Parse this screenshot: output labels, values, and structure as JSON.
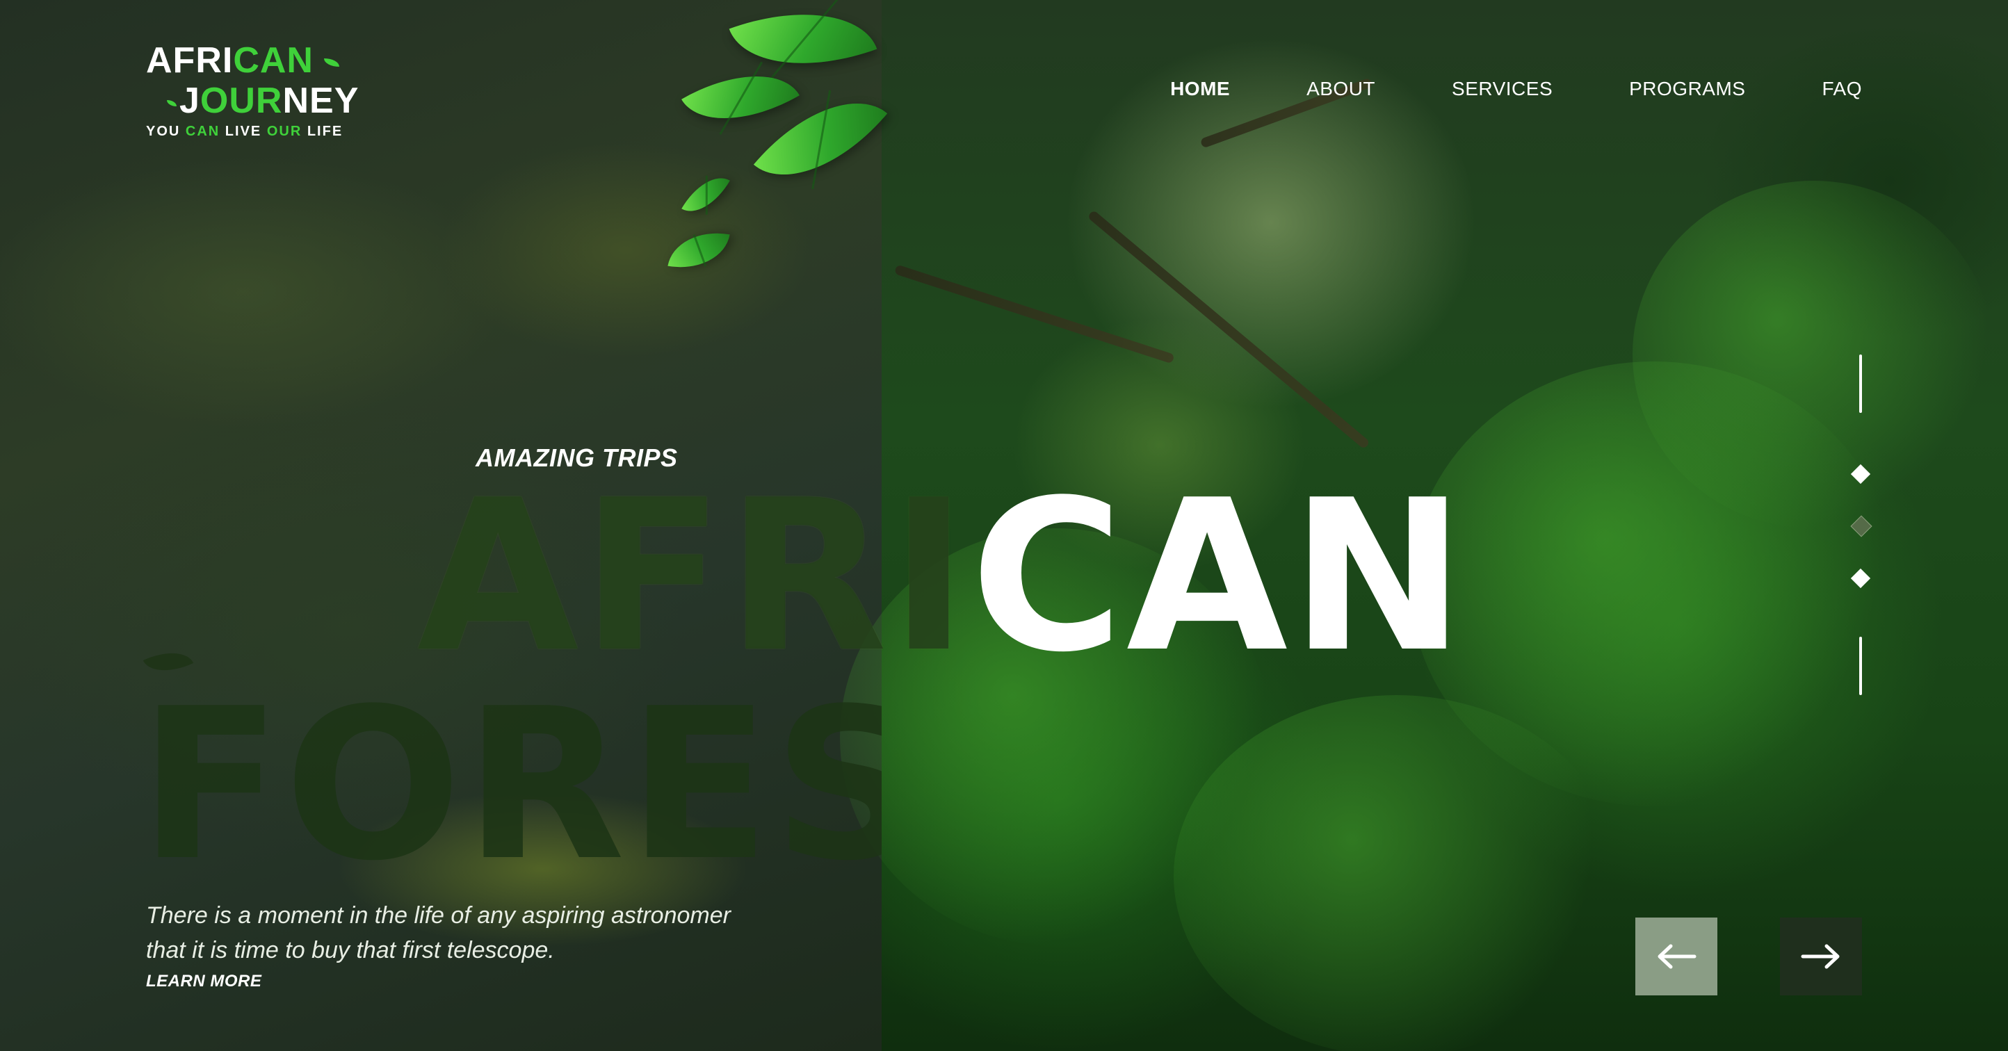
{
  "logo": {
    "line1_white": "AFRI",
    "line1_green": "CAN",
    "line2_white_a": "J",
    "line2_green": "OUR",
    "line2_white_b": "NEY",
    "tagline_a": "YOU ",
    "tagline_green_a": "CAN",
    "tagline_b": " LIVE ",
    "tagline_green_b": "OUR",
    "tagline_c": " LIFE"
  },
  "nav": {
    "items": [
      {
        "label": "HOME",
        "active": true
      },
      {
        "label": "ABOUT",
        "active": false
      },
      {
        "label": "SERVICES",
        "active": false
      },
      {
        "label": "PROGRAMS",
        "active": false
      },
      {
        "label": "FAQ",
        "active": false
      }
    ]
  },
  "hero": {
    "subtitle": "AMAZING TRIPS",
    "headline_dark": "AFRI",
    "headline_light": "CAN",
    "headline2": "FOREST",
    "description": "There is a moment in the life of any aspiring astronomer that it is time to buy that first telescope.",
    "learn_more": "LEARN MORE"
  },
  "slider": {
    "dots": [
      "active",
      "inactive",
      "active"
    ],
    "prev_icon": "arrow-left-icon",
    "next_icon": "arrow-right-icon"
  },
  "colors": {
    "accent_green": "#3fd13a",
    "prev_button_bg": "#8a9d85",
    "next_button_bg": "#1f2f1d"
  }
}
